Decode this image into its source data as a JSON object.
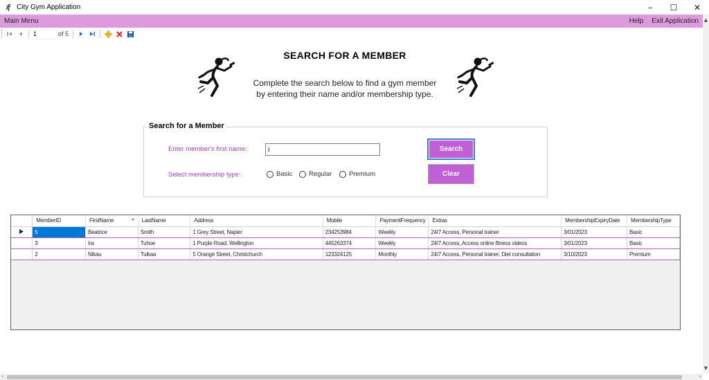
{
  "window": {
    "title": "City Gym Application",
    "minimize": "–",
    "maximize": "☐",
    "close": "✕"
  },
  "menu": {
    "main": "Main Menu",
    "help": "Help",
    "exit": "Exit Application"
  },
  "navigator": {
    "position": "1",
    "count": "of 5"
  },
  "header": {
    "title": "SEARCH FOR A MEMBER",
    "line1": "Complete the search below to find a gym member",
    "line2": "by entering their name and/or membership type."
  },
  "search": {
    "group_title": "Search for a Member",
    "first_name_label": "Enter member's first name:",
    "first_name_value": "i",
    "type_label": "Select membership type:",
    "options": [
      "Basic",
      "Regular",
      "Premium"
    ],
    "search_button": "Search",
    "clear_button": "Clear"
  },
  "grid": {
    "columns": [
      "MemberID",
      "FirstName",
      "LastName",
      "Address",
      "Mobile",
      "PaymentFrequency",
      "Extras",
      "MembershipExpiryDate",
      "MembershipType"
    ],
    "rows": [
      [
        "5",
        "Beatrice",
        "Smith",
        "1 Grey Street, Napier",
        "234253984",
        "Weekly",
        "24/7 Access, Personal trainer",
        "3/01/2023",
        "Basic"
      ],
      [
        "3",
        "Ira",
        "Tuhoe",
        "1 Purple Road, Wellington",
        "445263374",
        "Weekly",
        "24/7 Access, Access online fitness videos",
        "3/01/2023",
        "Basic"
      ],
      [
        "2",
        "Nikau",
        "Tuikaa",
        "5 Orange Street, Christchurch",
        "123324125",
        "Monthly",
        "24/7 Access, Personal trainer, Diet consultation",
        "3/10/2023",
        "Premium"
      ]
    ]
  },
  "colors": {
    "menu_bg": "#dd9bdd",
    "accent": "#c05fd6",
    "label": "#a63dcf",
    "selection": "#0078d7"
  }
}
